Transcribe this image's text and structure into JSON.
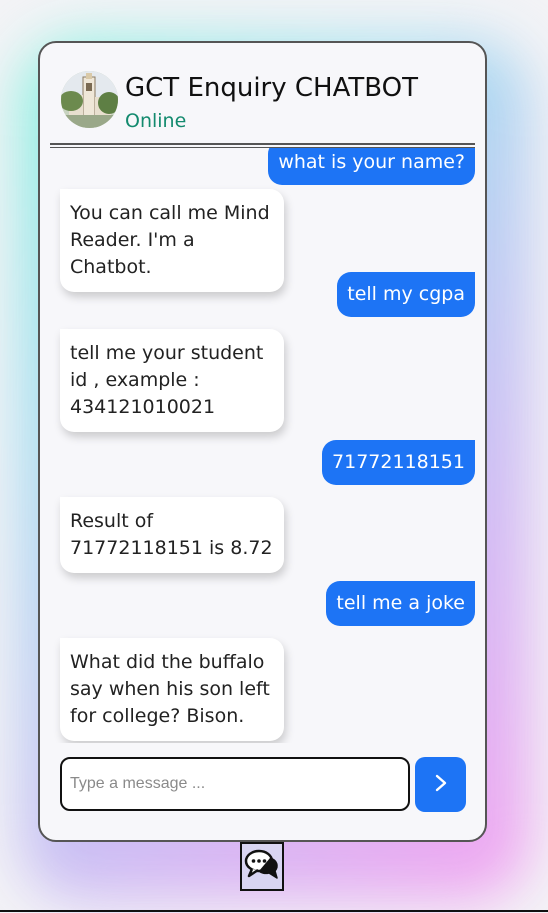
{
  "header": {
    "title": "GCT Enquiry CHATBOT",
    "status": "Online"
  },
  "messages": [
    {
      "sender": "user",
      "text": "what is your name?"
    },
    {
      "sender": "bot",
      "text": "You can call me Mind Reader. I'm a Chatbot."
    },
    {
      "sender": "user",
      "text": "tell my cgpa"
    },
    {
      "sender": "bot",
      "text": "tell me your student id , example : 434121010021"
    },
    {
      "sender": "user",
      "text": "71772118151"
    },
    {
      "sender": "bot",
      "text": "Result of 71772118151 is 8.72"
    },
    {
      "sender": "user",
      "text": "tell me a joke"
    },
    {
      "sender": "bot",
      "text": "What did the buffalo say when his son left for college? Bison."
    }
  ],
  "composer": {
    "placeholder": "Type a message ..."
  },
  "icons": {
    "avatar": "college-building-avatar",
    "send": "chevron-right-icon",
    "launcher": "chat-bubbles-icon"
  },
  "colors": {
    "user_bubble": "#1d74f5",
    "bot_bubble": "#ffffff",
    "status": "#138a6e"
  }
}
